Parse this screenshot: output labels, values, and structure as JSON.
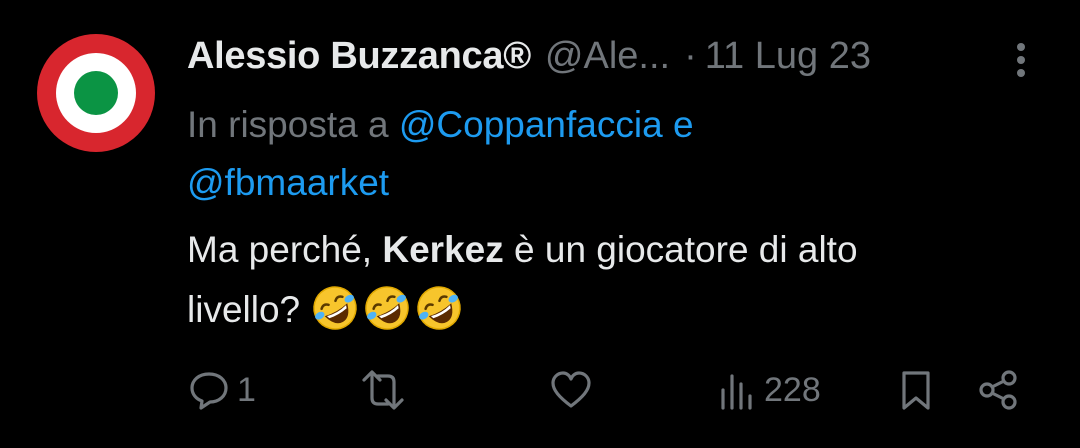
{
  "tweet": {
    "display_name": "Alessio Buzzanca®",
    "handle": "@Ale...",
    "separator": "·",
    "date": "11 Lug 23",
    "reply_prefix": "In risposta a",
    "reply_mention_1": "@Coppanfaccia",
    "reply_conjunction": "e",
    "reply_mention_2": "@fbmaarket",
    "text_before": "Ma perché,",
    "text_bold": "Kerkez",
    "text_after": "è un giocatore di alto",
    "text_line2": "livello?",
    "emojis": [
      "rolling-on-floor-laughing",
      "rolling-on-floor-laughing",
      "rolling-on-floor-laughing"
    ]
  },
  "actions": {
    "reply_count": "1",
    "retweet_count": "",
    "like_count": "",
    "views_count": "228"
  },
  "colors": {
    "background": "#000000",
    "text": "#e7e9ea",
    "secondary": "#71767b",
    "link": "#1d9bf0",
    "roundel_red": "#d8262e",
    "roundel_white": "#ffffff",
    "roundel_green": "#0b9444"
  }
}
